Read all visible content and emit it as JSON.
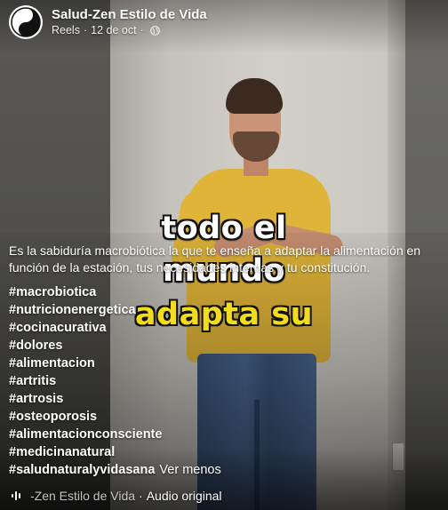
{
  "header": {
    "page_name": "Salud-Zen Estilo de Vida",
    "section": "Reels",
    "separator": "·",
    "date": "12 de oct",
    "privacy_icon": "globe-icon",
    "avatar_icon": "yin-yang-icon"
  },
  "video_overlay": {
    "line1": "todo el",
    "line2": "mundo",
    "line3": "adapta su",
    "highlight_color": "#f2dc1c"
  },
  "post": {
    "description": "Es la sabiduría macrobiótica la que te enseña a adaptar la alimentación en función de la estación, tus necesidades internas y tu constitución.",
    "hashtags": [
      "#macrobiotica",
      "#nutricionenergetica",
      "#cocinacurativa",
      "#dolores",
      "#alimentacion",
      "#artritis",
      "#artrosis",
      "#osteoporosis",
      "#alimentacionconsciente",
      "#medicinanatural",
      "#saludnaturalyvidasana"
    ],
    "see_less": "Ver menos"
  },
  "audio": {
    "icon": "audio-wave-icon",
    "page": "-Zen Estilo de Vida",
    "separator": "·",
    "label": "Audio original"
  }
}
